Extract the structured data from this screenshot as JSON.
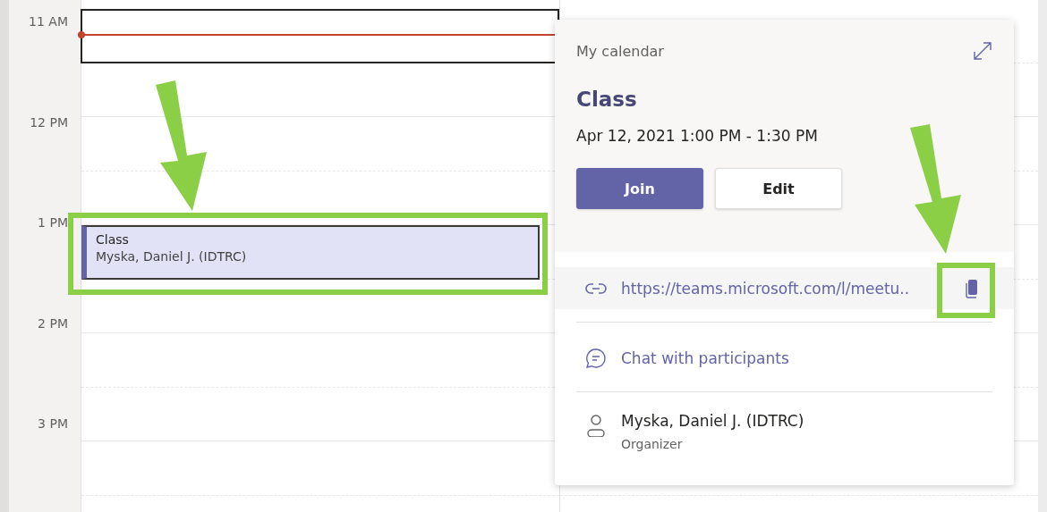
{
  "time_labels": [
    "11 AM",
    "12 PM",
    "1 PM",
    "2 PM",
    "3 PM"
  ],
  "event": {
    "title": "Class",
    "organizer": "Myska, Daniel J. (IDTRC)"
  },
  "popup": {
    "calendar": "My calendar",
    "title": "Class",
    "datetime": "Apr 12, 2021 1:00 PM - 1:30 PM",
    "buttons": [
      {
        "label": "Join",
        "kind": "primary"
      },
      {
        "label": "Edit",
        "kind": "secondary"
      }
    ],
    "link": "https://teams.microsoft.com/l/meetu..",
    "chat": "Chat with participants",
    "organizer": {
      "name": "Myska, Daniel J. (IDTRC)",
      "role": "Organizer"
    }
  }
}
